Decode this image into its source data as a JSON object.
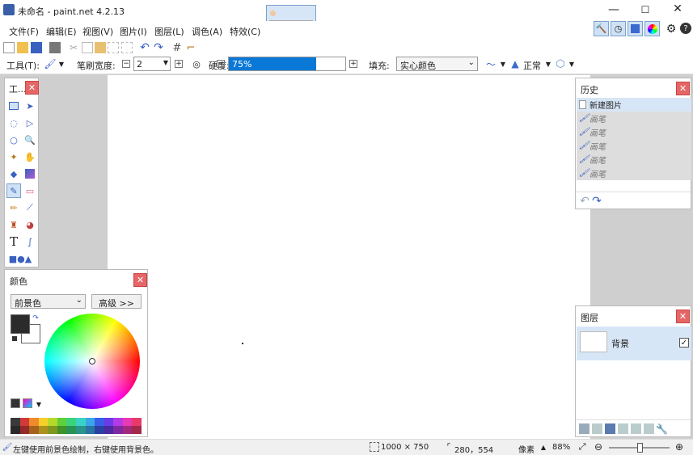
{
  "window": {
    "title": "未命名 - paint.net 4.2.13"
  },
  "menu": {
    "items": [
      "文件(F)",
      "编辑(E)",
      "视图(V)",
      "图片(I)",
      "图层(L)",
      "调色(A)",
      "特效(C)"
    ]
  },
  "toolbar": {
    "tool_label": "工具(T):",
    "brush_width_label": "笔刷宽度:",
    "brush_width_value": "2",
    "hardness_label": "硬度:",
    "hardness_value": "75%",
    "hardness_fraction": 0.75,
    "fill_label": "填充:",
    "fill_value": "实心颜色",
    "blend_mode": "正常"
  },
  "tools_panel": {
    "title": "工..."
  },
  "history_panel": {
    "title": "历史",
    "items": [
      "新建图片",
      "画笔",
      "画笔",
      "画笔",
      "画笔",
      "画笔"
    ]
  },
  "layers_panel": {
    "title": "图层",
    "layers": [
      {
        "name": "背景",
        "visible": true
      }
    ]
  },
  "colors_panel": {
    "title": "颜色",
    "target": "前景色",
    "advanced_button": "高级 >>",
    "primary_color": "#2b2b2b",
    "secondary_color": "#ffffff"
  },
  "status": {
    "hint": "左键使用前景色绘制，右键使用背景色。",
    "image_size": "1000 × 750",
    "cursor_position": "280，554",
    "units": "像素",
    "zoom": "88%"
  },
  "palette": [
    "#3a3a3a",
    "#d23a3a",
    "#f08a2a",
    "#f5d02a",
    "#b6d82a",
    "#5fcf3a",
    "#3ad27a",
    "#3ad2c8",
    "#3aa6e8",
    "#3a5ee8",
    "#6a3ae8",
    "#b43ae8",
    "#e83ab4",
    "#e83a6a"
  ]
}
